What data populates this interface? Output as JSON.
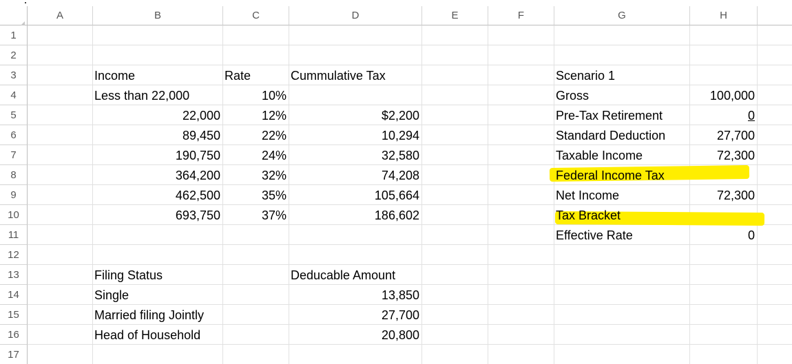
{
  "columns": [
    "A",
    "B",
    "C",
    "D",
    "E",
    "F",
    "G",
    "H"
  ],
  "rows": [
    "1",
    "2",
    "3",
    "4",
    "5",
    "6",
    "7",
    "8",
    "9",
    "10",
    "11",
    "12",
    "13",
    "14",
    "15",
    "16",
    "17"
  ],
  "tax_table": {
    "headers": {
      "income": "Income",
      "rate": "Rate",
      "cumulative": "Cummulative Tax"
    },
    "rows": [
      {
        "income": "Less than 22,000",
        "rate": "10%",
        "cumulative": ""
      },
      {
        "income": "22,000",
        "rate": "12%",
        "cumulative": "$2,200"
      },
      {
        "income": "89,450",
        "rate": "22%",
        "cumulative": "10,294"
      },
      {
        "income": "190,750",
        "rate": "24%",
        "cumulative": "32,580"
      },
      {
        "income": "364,200",
        "rate": "32%",
        "cumulative": "74,208"
      },
      {
        "income": "462,500",
        "rate": "35%",
        "cumulative": "105,664"
      },
      {
        "income": "693,750",
        "rate": "37%",
        "cumulative": "186,602"
      }
    ]
  },
  "deduction_table": {
    "headers": {
      "status": "Filing Status",
      "amount": "Deducable Amount"
    },
    "rows": [
      {
        "status": "Single",
        "amount": "13,850"
      },
      {
        "status": "Married filing Jointly",
        "amount": "27,700"
      },
      {
        "status": "Head of Household",
        "amount": "20,800"
      }
    ]
  },
  "scenario": {
    "title": "Scenario 1",
    "rows": [
      {
        "label": "Gross",
        "value": "100,000"
      },
      {
        "label": "Pre-Tax Retirement",
        "value": "0"
      },
      {
        "label": "Standard Deduction",
        "value": "27,700"
      },
      {
        "label": "Taxable Income",
        "value": "72,300"
      },
      {
        "label": "Federal Income Tax",
        "value": ""
      },
      {
        "label": "Net Income",
        "value": "72,300"
      },
      {
        "label": "Tax Bracket",
        "value": ""
      },
      {
        "label": "Effective Rate",
        "value": "0"
      }
    ]
  },
  "colors": {
    "highlight": "#ffee00",
    "grid": "#e1e1e1",
    "header_text": "#555555"
  }
}
